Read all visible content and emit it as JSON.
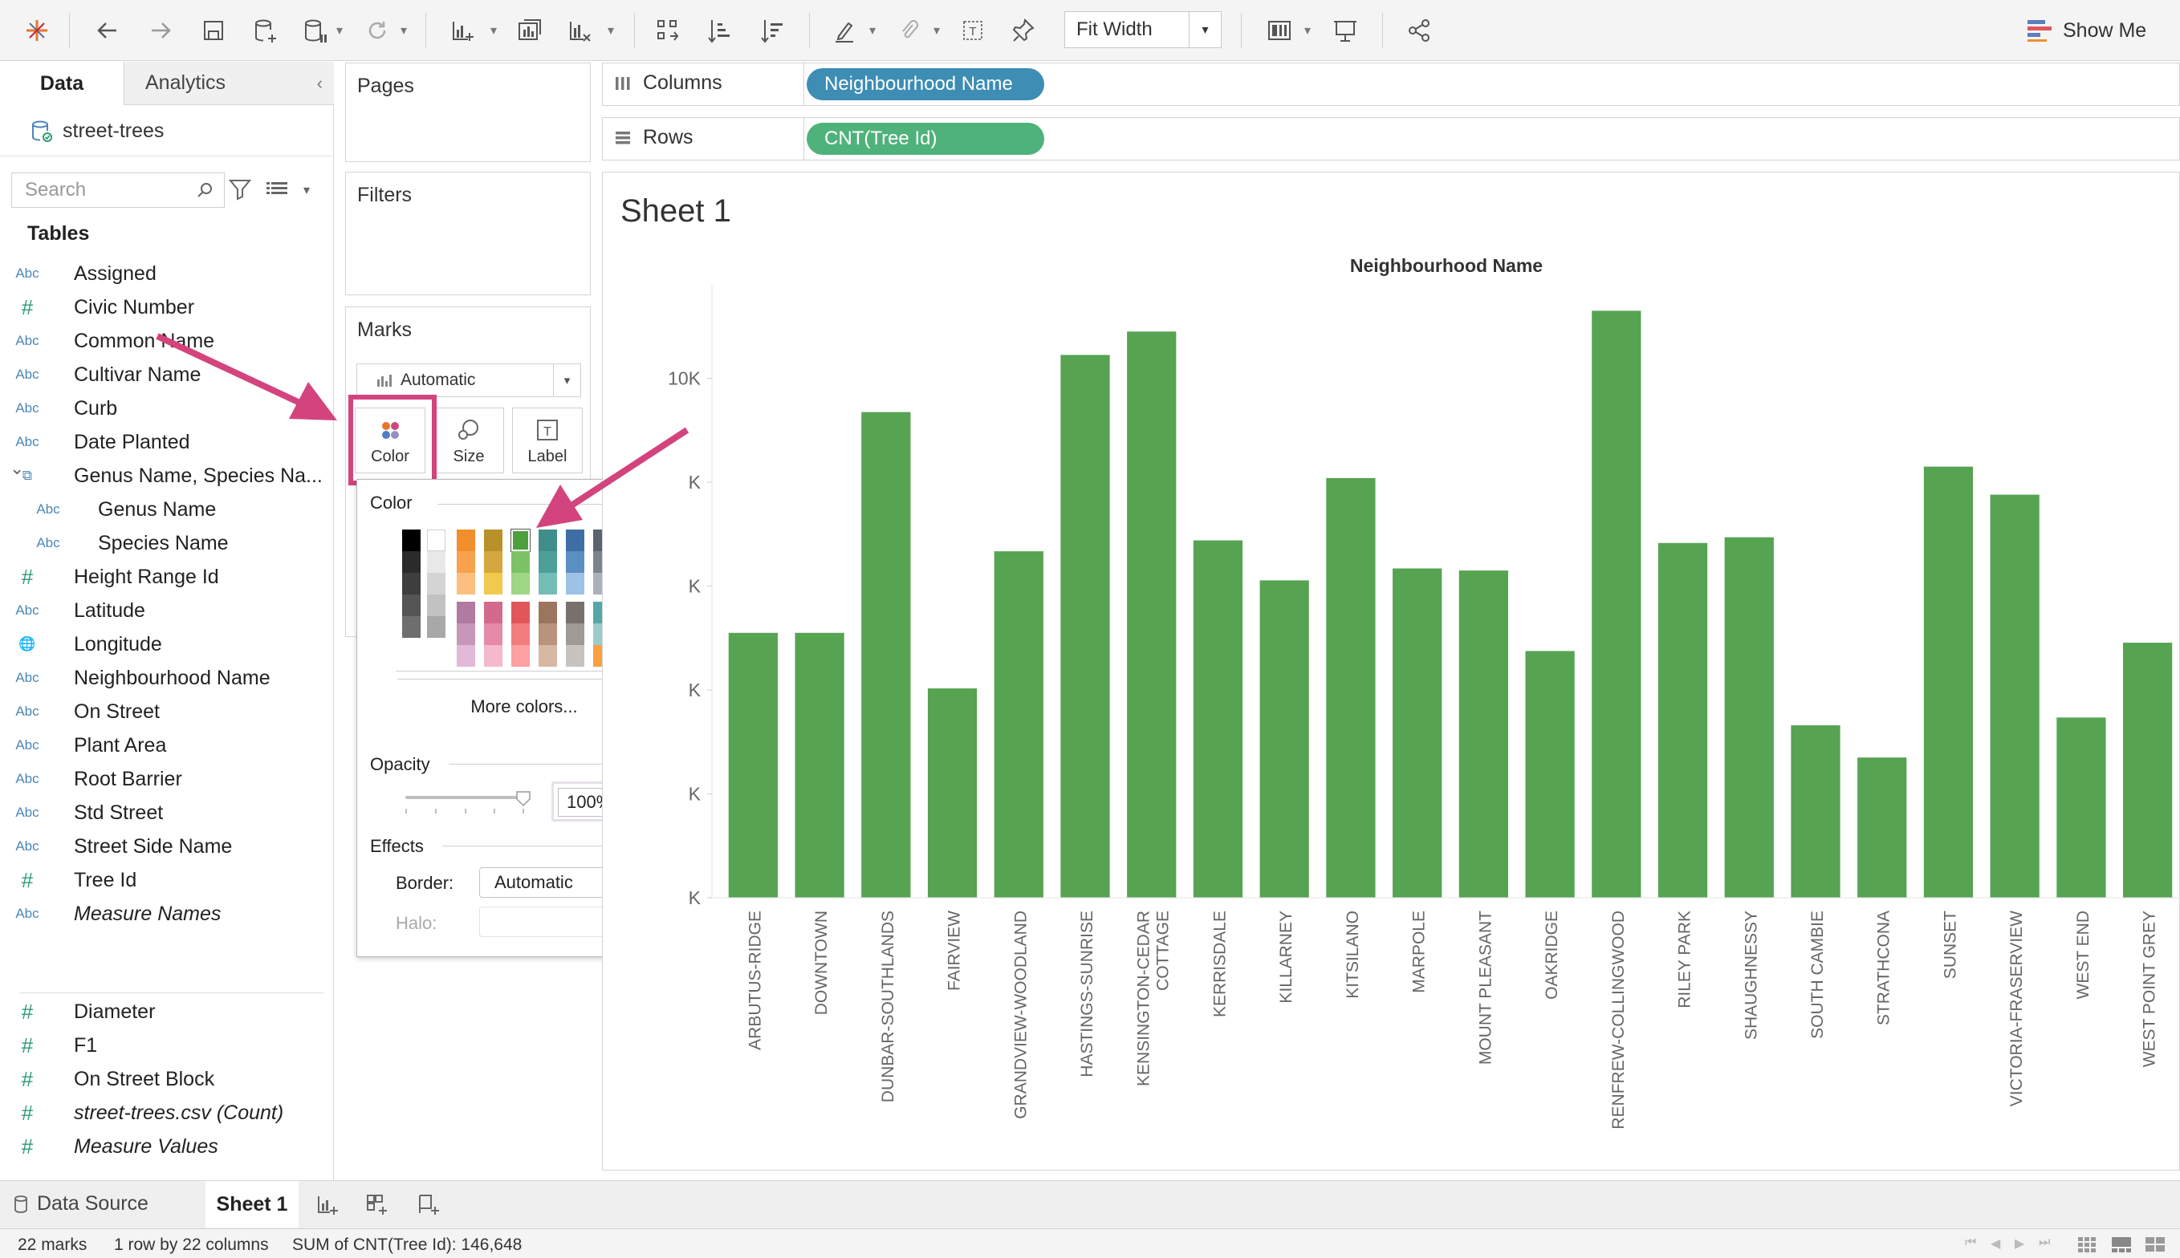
{
  "toolbar": {
    "fit_mode": "Fit Width",
    "show_me": "Show Me"
  },
  "data_pane": {
    "tabs": [
      "Data",
      "Analytics"
    ],
    "datasource": "street-trees",
    "search_placeholder": "Search",
    "tables_heading": "Tables",
    "fields": [
      {
        "type": "Abc",
        "name": "Assigned"
      },
      {
        "type": "#",
        "name": "Civic Number"
      },
      {
        "type": "Abc",
        "name": "Common Name"
      },
      {
        "type": "Abc",
        "name": "Cultivar Name"
      },
      {
        "type": "Abc",
        "name": "Curb"
      },
      {
        "type": "Abc",
        "name": "Date Planted"
      },
      {
        "type": "hier",
        "name": "Genus Name, Species Na..."
      },
      {
        "type": "Abc",
        "name": "Genus Name",
        "indent": true
      },
      {
        "type": "Abc",
        "name": "Species Name",
        "indent": true
      },
      {
        "type": "#",
        "name": "Height Range Id"
      },
      {
        "type": "Abc",
        "name": "Latitude"
      },
      {
        "type": "geo",
        "name": "Longitude"
      },
      {
        "type": "Abc",
        "name": "Neighbourhood Name"
      },
      {
        "type": "Abc",
        "name": "On Street"
      },
      {
        "type": "Abc",
        "name": "Plant Area"
      },
      {
        "type": "Abc",
        "name": "Root Barrier"
      },
      {
        "type": "Abc",
        "name": "Std Street"
      },
      {
        "type": "Abc",
        "name": "Street Side Name"
      },
      {
        "type": "#",
        "name": "Tree Id"
      },
      {
        "type": "Abc",
        "name": "Measure Names",
        "italic": true
      }
    ],
    "measures": [
      {
        "type": "#",
        "name": "Diameter"
      },
      {
        "type": "#",
        "name": "F1"
      },
      {
        "type": "#",
        "name": "On Street Block"
      },
      {
        "type": "#",
        "name": "street-trees.csv (Count)",
        "italic": true
      },
      {
        "type": "#",
        "name": "Measure Values",
        "italic": true
      }
    ]
  },
  "cards": {
    "pages": "Pages",
    "filters": "Filters",
    "marks": "Marks",
    "mark_type": "Automatic",
    "mark_buttons": [
      "Color",
      "Size",
      "Label"
    ]
  },
  "color_popup": {
    "color_heading": "Color",
    "more_colors": "More colors...",
    "opacity_heading": "Opacity",
    "opacity_value": "100%",
    "opacity": 1.0,
    "effects_heading": "Effects",
    "border_label": "Border:",
    "border_value": "Automatic",
    "halo_label": "Halo:",
    "palette": {
      "gray_col_1": [
        "#000000",
        "#2b2b2b",
        "#3e3e3e",
        "#555555",
        "#6e6e6e"
      ],
      "gray_col_2": [
        "#ffffff",
        "#e8e8e8",
        "#d4d4d4",
        "#c2c2c2",
        "#a8a8a8"
      ],
      "top_grid": [
        [
          "#f28e2b",
          "#b8912a",
          "#4e9f3d",
          "#3e8f8b",
          "#3f6ea5",
          "#5a6270"
        ],
        [
          "#f8a24e",
          "#d5a73e",
          "#7ec266",
          "#4da09a",
          "#5b8fc2",
          "#7b838f"
        ],
        [
          "#fcbf7f",
          "#f2c94c",
          "#9ed685",
          "#74bcb6",
          "#9ec2e6",
          "#aab1ba"
        ]
      ],
      "bottom_grid": [
        [
          "#b07aa1",
          "#d36a8e",
          "#e15759",
          "#9c755f",
          "#79706e",
          "#56a6a6"
        ],
        [
          "#c797b9",
          "#e58aa9",
          "#f27c7e",
          "#b9937c",
          "#a09a96",
          "#9ccbcb"
        ],
        [
          "#e2b9d6",
          "#f5b8cc",
          "#fda0a2",
          "#d6b8a4",
          "#c9c3bf",
          "#f9a03f"
        ]
      ],
      "bottom_grid_last": [
        "#f7b8c8",
        "#f2c14e"
      ],
      "selected": "#4e9f3d"
    }
  },
  "shelves": {
    "columns_label": "Columns",
    "rows_label": "Rows",
    "columns_pill": "Neighbourhood Name",
    "rows_pill": "CNT(Tree Id)"
  },
  "sheet": {
    "title": "Sheet 1"
  },
  "chart_data": {
    "type": "bar",
    "title": "Neighbourhood Name",
    "bar_color": "#56a352",
    "y_tick_labels": [
      "10K",
      "K",
      "K",
      "K",
      "K",
      "K"
    ],
    "y_ticks": [
      10000,
      8000,
      6000,
      4000,
      2000,
      0
    ],
    "ylim": [
      0,
      11800
    ],
    "categories": [
      "ARBUTUS-RIDGE",
      "DOWNTOWN",
      "DUNBAR-SOUTHLANDS",
      "FAIRVIEW",
      "GRANDVIEW-WOODLAND",
      "HASTINGS-SUNRISE",
      "KENSINGTON-CEDAR COTTAGE",
      "KERRISDALE",
      "KILLARNEY",
      "KITSILANO",
      "MARPOLE",
      "MOUNT PLEASANT",
      "OAKRIDGE",
      "RENFREW-COLLINGWOOD",
      "RILEY PARK",
      "SHAUGHNESSY",
      "SOUTH CAMBIE",
      "STRATHCONA",
      "SUNSET",
      "VICTORIA-FRASERVIEW",
      "WEST END",
      "WEST POINT GREY"
    ],
    "values": [
      5100,
      5100,
      9350,
      4030,
      6670,
      10450,
      10900,
      6880,
      6110,
      8080,
      6340,
      6300,
      4750,
      11300,
      6830,
      6940,
      3320,
      2700,
      8300,
      7760,
      3470,
      4910
    ]
  },
  "bottom_tabs": {
    "data_source": "Data Source",
    "sheet": "Sheet 1"
  },
  "status": {
    "marks": "22 marks",
    "dims": "1 row by 22 columns",
    "sum": "SUM of CNT(Tree Id): 146,648"
  }
}
